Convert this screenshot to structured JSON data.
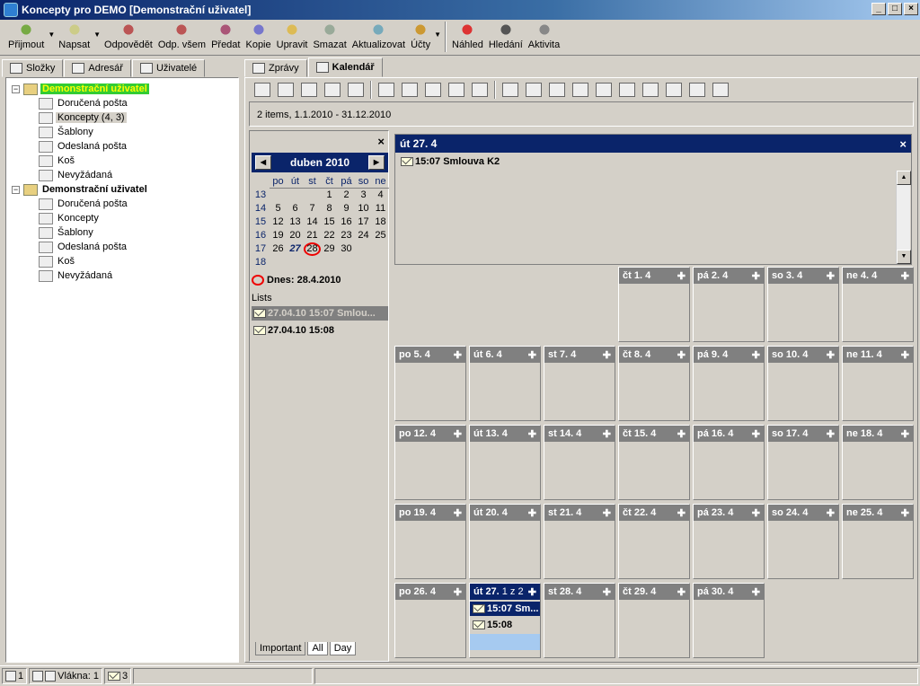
{
  "window": {
    "title": "Koncepty pro DEMO [Demonstrační uživatel]"
  },
  "toolbar": {
    "buttons": [
      {
        "label": "Přijmout",
        "icon": "receive-icon"
      },
      {
        "label": "Napsat",
        "icon": "write-icon"
      },
      {
        "label": "Odpovědět",
        "icon": "reply-icon"
      },
      {
        "label": "Odp. všem",
        "icon": "reply-all-icon"
      },
      {
        "label": "Předat",
        "icon": "forward-icon"
      },
      {
        "label": "Kopie",
        "icon": "copy-icon"
      },
      {
        "label": "Upravit",
        "icon": "edit-icon"
      },
      {
        "label": "Smazat",
        "icon": "delete-icon"
      },
      {
        "label": "Aktualizovat",
        "icon": "refresh-icon"
      },
      {
        "label": "Účty",
        "icon": "accounts-icon"
      },
      {
        "label": "Náhled",
        "icon": "preview-icon"
      },
      {
        "label": "Hledání",
        "icon": "search-icon"
      },
      {
        "label": "Aktivita",
        "icon": "activity-icon"
      }
    ]
  },
  "left_tabs": [
    "Složky",
    "Adresář",
    "Uživatelé"
  ],
  "tree": {
    "groups": [
      {
        "root": "Demonstrační uživatel",
        "items": [
          "Doručená pošta",
          "Koncepty (4, 3)",
          "Šablony",
          "Odeslaná pošta",
          "Koš",
          "Nevyžádaná"
        ]
      },
      {
        "root": "Demonstrační uživatel",
        "items": [
          "Doručená pošta",
          "Koncepty",
          "Šablony",
          "Odeslaná pošta",
          "Koš",
          "Nevyžádaná"
        ]
      }
    ]
  },
  "right_tabs": [
    "Zprávy",
    "Kalendář"
  ],
  "info": {
    "text": "2 items, 1.1.2010 - 31.12.2010"
  },
  "minical": {
    "month": "duben 2010",
    "weekdays": [
      "po",
      "út",
      "st",
      "čt",
      "pá",
      "so",
      "ne"
    ],
    "weeks": [
      {
        "wk": "13",
        "days": [
          "",
          "",
          "",
          "1",
          "2",
          "3",
          "4"
        ]
      },
      {
        "wk": "14",
        "days": [
          "5",
          "6",
          "7",
          "8",
          "9",
          "10",
          "11"
        ]
      },
      {
        "wk": "15",
        "days": [
          "12",
          "13",
          "14",
          "15",
          "16",
          "17",
          "18"
        ]
      },
      {
        "wk": "16",
        "days": [
          "19",
          "20",
          "21",
          "22",
          "23",
          "24",
          "25"
        ]
      },
      {
        "wk": "17",
        "days": [
          "26",
          "27",
          "28",
          "29",
          "30",
          "",
          ""
        ]
      },
      {
        "wk": "18",
        "days": [
          "",
          "",
          "",
          "",
          "",
          "",
          ""
        ]
      }
    ],
    "selected": "27",
    "today": "28",
    "today_label": "Dnes: 28.4.2010"
  },
  "lists": {
    "heading": "Lists",
    "items": [
      "27.04.10 15:07 Smlou...",
      "27.04.10 15:08"
    ]
  },
  "bottom_tabs": [
    "Important",
    "All",
    "Day"
  ],
  "day_panel": {
    "title": "út 27. 4",
    "item": "15:07 Smlouva K2"
  },
  "calendar": {
    "weeks": [
      [
        "",
        "",
        "",
        "čt 1. 4",
        "pá 2. 4",
        "so 3. 4",
        "ne 4. 4"
      ],
      [
        "po 5. 4",
        "út 6. 4",
        "st 7. 4",
        "čt 8. 4",
        "pá 9. 4",
        "so 10. 4",
        "ne 11. 4"
      ],
      [
        "po 12. 4",
        "út 13. 4",
        "st 14. 4",
        "čt 15. 4",
        "pá 16. 4",
        "so 17. 4",
        "ne 18. 4"
      ],
      [
        "po 19. 4",
        "út 20. 4",
        "st 21. 4",
        "čt 22. 4",
        "pá 23. 4",
        "so 24. 4",
        "ne 25. 4"
      ],
      [
        "po 26. 4",
        "út 27.",
        "st 28. 4",
        "čt 29. 4",
        "pá 30. 4",
        "",
        ""
      ]
    ],
    "today_cell": {
      "pager": "1 z 2",
      "events": [
        "15:07 Sm...",
        "15:08"
      ]
    }
  },
  "status": {
    "p1": "1",
    "threads": "Vlákna: 1",
    "mails": "3"
  },
  "colors": {
    "title_bg": "#0a246a",
    "accent_green": "#33cc33",
    "cell_header": "#808080"
  }
}
